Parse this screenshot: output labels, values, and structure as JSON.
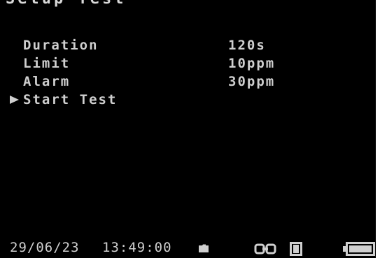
{
  "header": {
    "title": "Setup Test"
  },
  "menu": {
    "items": [
      {
        "label": "Duration",
        "value": "120s"
      },
      {
        "label": "Limit",
        "value": "10ppm"
      },
      {
        "label": "Alarm",
        "value": "30ppm"
      },
      {
        "label": "Start Test",
        "value": ""
      }
    ],
    "selected_item": "Start Test"
  },
  "status_bar": {
    "date": "29/06/23",
    "time": "13:49:00",
    "icons": [
      "folder-icon",
      "link-icon",
      "memory-card-icon",
      "battery-icon"
    ]
  },
  "colors": {
    "background": "#000000",
    "foreground": "#cfcfcf"
  }
}
